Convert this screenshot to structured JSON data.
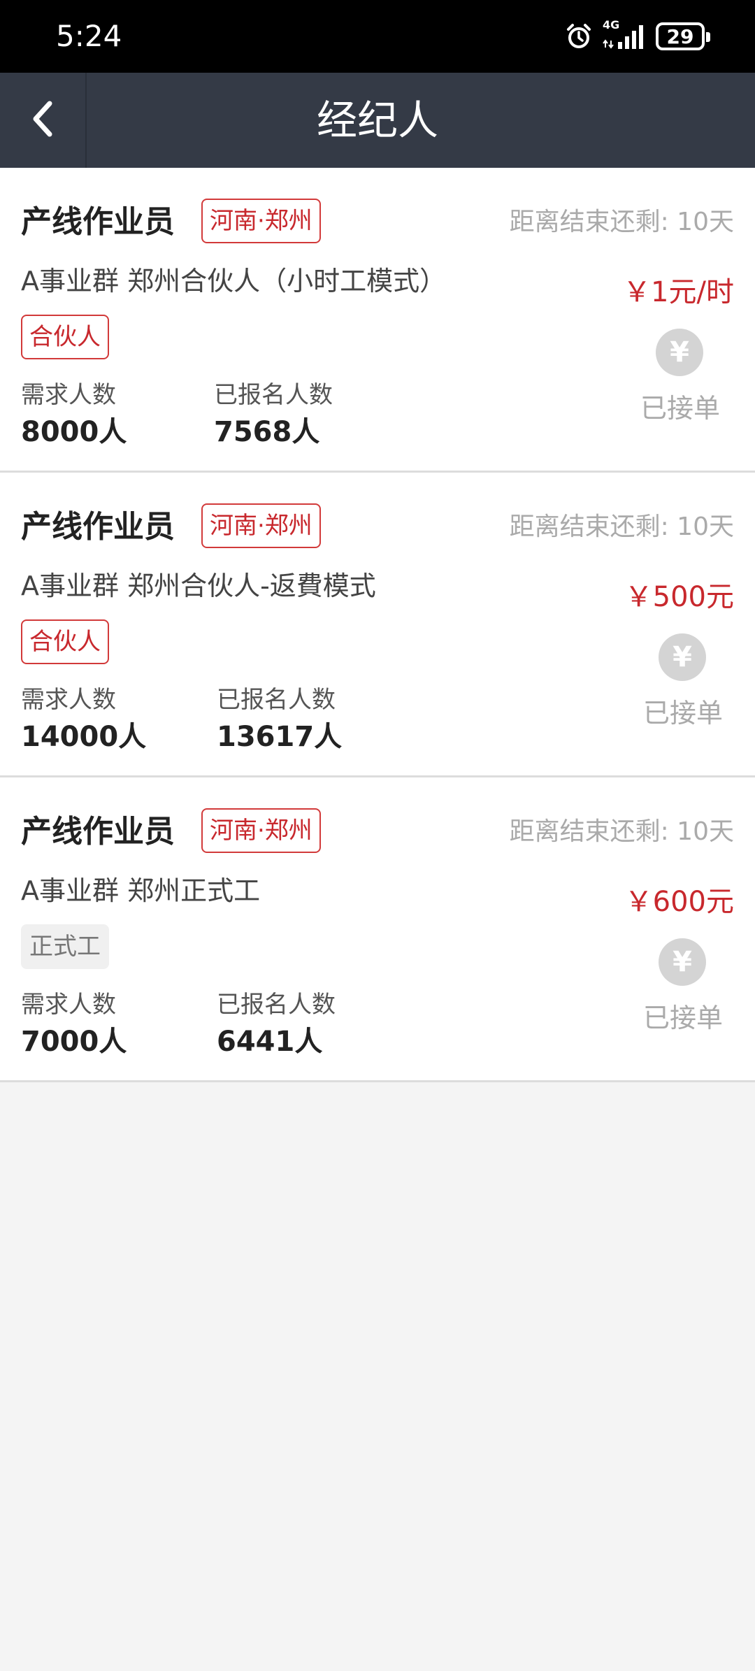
{
  "status_bar": {
    "time": "5:24",
    "network": "4G",
    "battery": "29",
    "icons": [
      "alarm-icon",
      "signal-icon",
      "battery-icon"
    ]
  },
  "header": {
    "title": "经纪人",
    "back_icon": "chevron-left-icon"
  },
  "colors": {
    "header_bg": "#343a46",
    "accent_red": "#c8282d",
    "muted_gray": "#aaaaaa",
    "page_bg": "#f4f4f4"
  },
  "jobs": [
    {
      "title": "产线作业员",
      "location": "河南·郑州",
      "time_remaining": "距离结束还剩: 10天",
      "subtitle": "A事业群 郑州合伙人（小时工模式）",
      "tag": "合伙人",
      "demand_label": "需求人数",
      "demand_value": "8000人",
      "registered_label": "已报名人数",
      "registered_value": "7568人",
      "price": "￥1元/时",
      "yen_icon": "¥",
      "status": "已接单"
    },
    {
      "title": "产线作业员",
      "location": "河南·郑州",
      "time_remaining": "距离结束还剩: 10天",
      "subtitle": "A事业群 郑州合伙人-返費模式",
      "tag": "合伙人",
      "demand_label": "需求人数",
      "demand_value": "14000人",
      "registered_label": "已报名人数",
      "registered_value": "13617人",
      "price": "￥500元",
      "yen_icon": "¥",
      "status": "已接单"
    },
    {
      "title": "产线作业员",
      "location": "河南·郑州",
      "time_remaining": "距离结束还剩: 10天",
      "subtitle": "A事业群 郑州正式工",
      "tag": "正式工",
      "demand_label": "需求人数",
      "demand_value": "7000人",
      "registered_label": "已报名人数",
      "registered_value": "6441人",
      "price": "￥600元",
      "yen_icon": "¥",
      "status": "已接单"
    }
  ]
}
